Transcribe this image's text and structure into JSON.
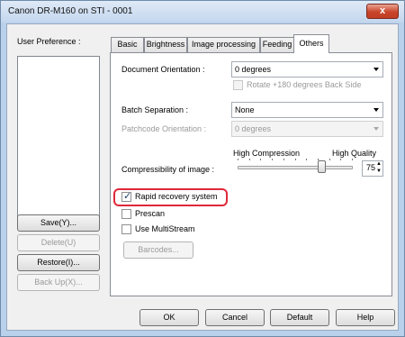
{
  "window": {
    "title": "Canon DR-M160 on STI - 0001",
    "close_label": "x"
  },
  "left": {
    "user_preference_label": "User Preference :",
    "buttons": {
      "save": "Save(Y)...",
      "delete": "Delete(U)",
      "restore": "Restore(I)...",
      "backup": "Back Up(X)..."
    }
  },
  "tabs": [
    "Basic",
    "Brightness",
    "Image processing",
    "Feeding",
    "Others"
  ],
  "active_tab": "Others",
  "others": {
    "doc_orientation_label": "Document Orientation :",
    "doc_orientation_value": "0 degrees",
    "rotate_back_label": "Rotate +180 degrees Back Side",
    "batch_sep_label": "Batch Separation :",
    "batch_sep_value": "None",
    "patchcode_label": "Patchcode Orientation :",
    "patchcode_value": "0 degrees",
    "high_compression": "High Compression",
    "high_quality": "High Quality",
    "compressibility_label": "Compressibility of image :",
    "compressibility_value": "75",
    "compressibility_level": 0.75,
    "rapid_recovery_label": "Rapid recovery system",
    "rapid_recovery_checked": true,
    "prescan_label": "Prescan",
    "multistream_label": "Use MultiStream",
    "barcodes_button": "Barcodes..."
  },
  "footer": {
    "ok": "OK",
    "cancel": "Cancel",
    "default": "Default",
    "help": "Help"
  },
  "colors": {
    "highlight": "#e0283a",
    "window_frame": "#b9d1ea"
  }
}
